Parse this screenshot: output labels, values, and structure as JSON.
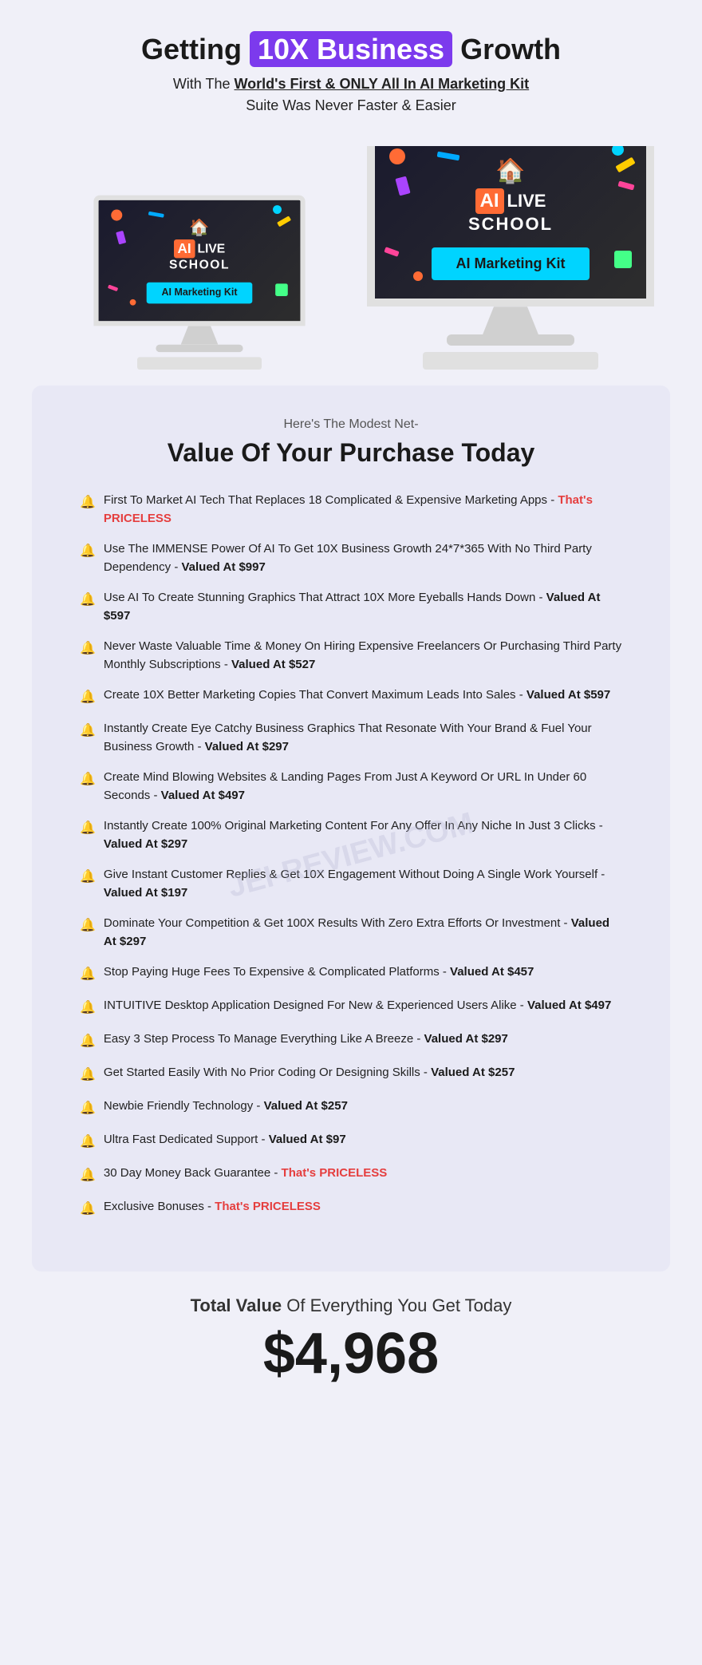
{
  "header": {
    "title_part1": "Getting ",
    "title_highlight": "10X Business",
    "title_part2": " Growth",
    "subtitle_part1": "With The ",
    "subtitle_underline": "World's First & ONLY All In AI Marketing Kit",
    "subtitle2": "Suite Was Never Faster & Easier"
  },
  "monitors": {
    "brand_ai": "AI",
    "brand_live": "LIVE",
    "brand_school": "SCHOOL",
    "banner_text": "AI Marketing Kit"
  },
  "value_section": {
    "net_label": "Here's The Modest Net-",
    "title": "Value Of Your Purchase Today",
    "items": [
      {
        "text": "First To Market AI Tech That Replaces 18 Complicated & Expensive Marketing Apps - ",
        "highlight": "That's PRICELESS",
        "highlight_type": "priceless"
      },
      {
        "text": "Use The IMMENSE Power Of AI To Get 10X Business Growth 24*7*365 With No Third Party Dependency - ",
        "highlight": "Valued At $997",
        "highlight_type": "valued"
      },
      {
        "text": "Use AI To Create Stunning Graphics That Attract 10X More Eyeballs Hands Down - ",
        "highlight": "Valued At $597",
        "highlight_type": "valued"
      },
      {
        "text": "Never Waste Valuable Time & Money On Hiring Expensive Freelancers Or Purchasing Third Party Monthly Subscriptions - ",
        "highlight": "Valued At $527",
        "highlight_type": "valued"
      },
      {
        "text": "Create 10X Better Marketing Copies That Convert Maximum Leads Into Sales - ",
        "highlight": "Valued At $597",
        "highlight_type": "valued"
      },
      {
        "text": "Instantly Create Eye Catchy Business Graphics That Resonate With Your Brand & Fuel Your Business Growth - ",
        "highlight": "Valued At $297",
        "highlight_type": "valued"
      },
      {
        "text": "Create Mind Blowing Websites & Landing Pages From Just A Keyword Or URL In Under 60 Seconds - ",
        "highlight": "Valued At $497",
        "highlight_type": "valued"
      },
      {
        "text": "Instantly Create 100% Original Marketing Content For Any Offer In Any Niche In Just 3 Clicks - ",
        "highlight": "Valued At $297",
        "highlight_type": "valued"
      },
      {
        "text": "Give Instant Customer Replies & Get 10X Engagement Without Doing A Single Work Yourself - ",
        "highlight": "Valued At $197",
        "highlight_type": "valued"
      },
      {
        "text": "Dominate Your Competition & Get 100X Results With Zero Extra Efforts Or Investment - ",
        "highlight": "Valued At $297",
        "highlight_type": "valued"
      },
      {
        "text": "Stop Paying Huge Fees To Expensive & Complicated Platforms - ",
        "highlight": "Valued At $457",
        "highlight_type": "valued"
      },
      {
        "text": "INTUITIVE Desktop Application Designed For New & Experienced Users Alike - ",
        "highlight": "Valued At $497",
        "highlight_type": "valued"
      },
      {
        "text": "Easy 3 Step Process To Manage Everything Like A Breeze - ",
        "highlight": "Valued At $297",
        "highlight_type": "valued"
      },
      {
        "text": "Get Started Easily With No Prior Coding Or Designing Skills - ",
        "highlight": "Valued At $257",
        "highlight_type": "valued"
      },
      {
        "text": "Newbie Friendly Technology - ",
        "highlight": "Valued At $257",
        "highlight_type": "valued"
      },
      {
        "text": "Ultra Fast Dedicated Support - ",
        "highlight": "Valued At $97",
        "highlight_type": "valued"
      },
      {
        "text": "30 Day Money Back Guarantee - ",
        "highlight": "That's PRICELESS",
        "highlight_type": "priceless",
        "bell_gold": true
      },
      {
        "text": "Exclusive Bonuses - ",
        "highlight": "That's PRICELESS",
        "highlight_type": "priceless",
        "bell_gold": true
      }
    ]
  },
  "total": {
    "label_part1": "Total Value",
    "label_part2": " Of Everything You Get Today",
    "price": "$4,968"
  },
  "watermark": {
    "text": "JEI-REVIEW.COM"
  }
}
